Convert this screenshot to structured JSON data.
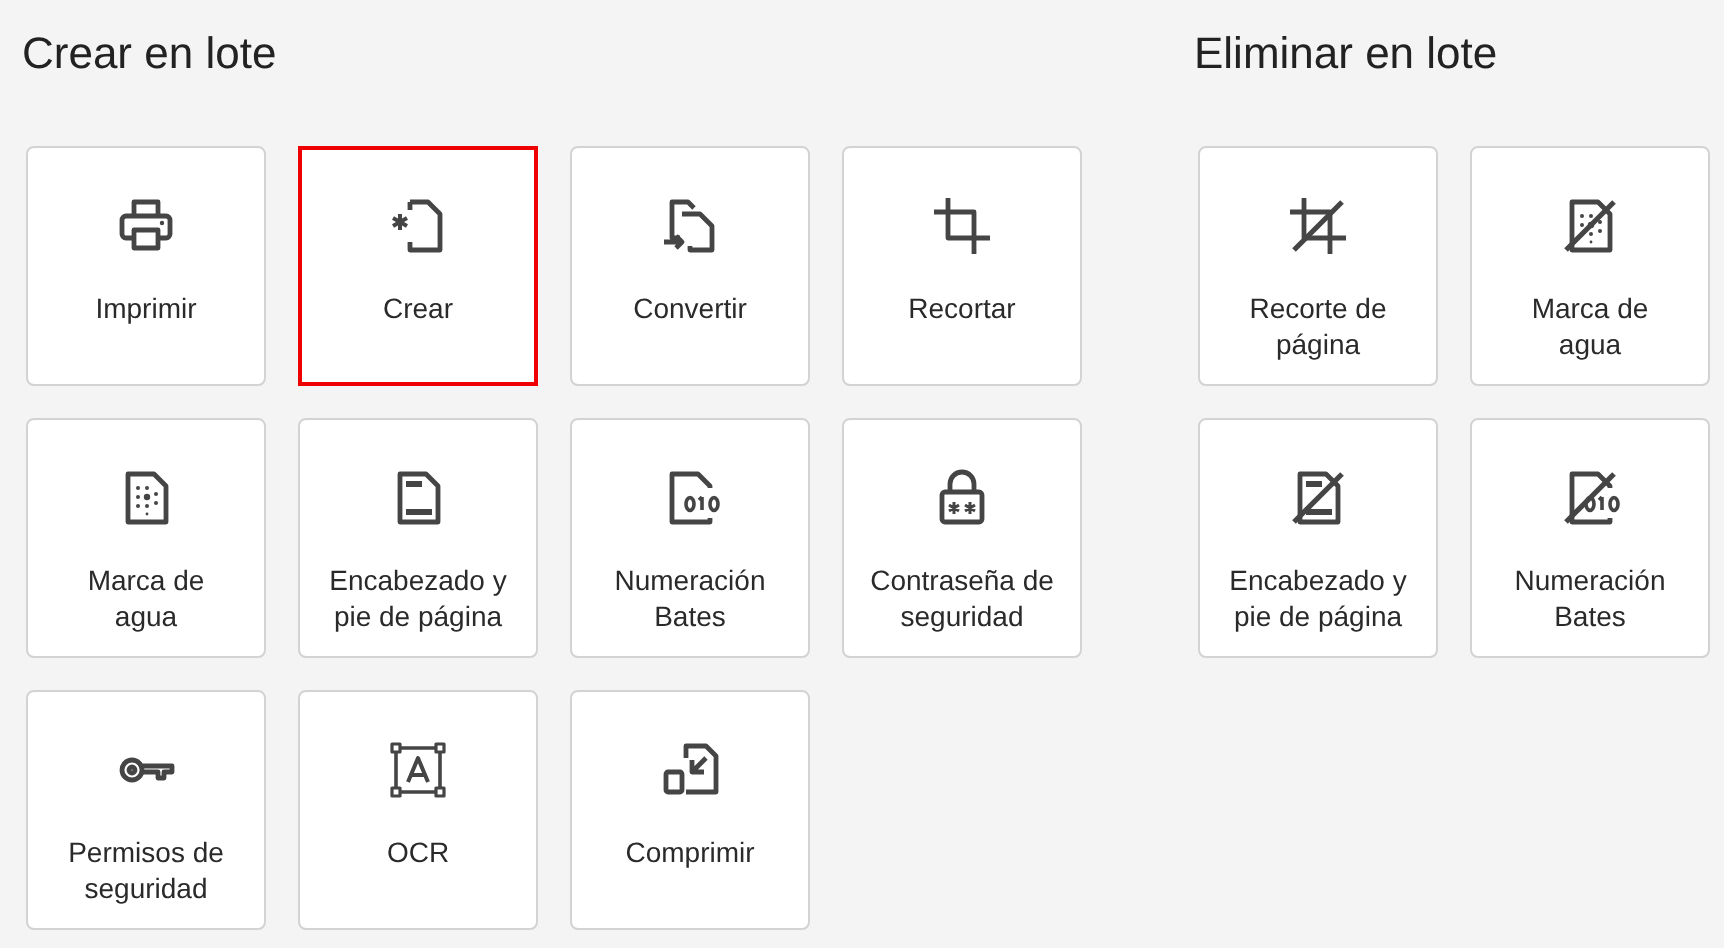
{
  "sections": [
    {
      "title": "Crear en lote",
      "items": [
        {
          "label": "Imprimir",
          "kind": "print",
          "selected": false
        },
        {
          "label": "Crear",
          "kind": "new",
          "selected": true
        },
        {
          "label": "Convertir",
          "kind": "convert",
          "selected": false
        },
        {
          "label": "Recortar",
          "kind": "crop",
          "selected": false
        },
        {
          "label": "Marca de\nagua",
          "kind": "watermark",
          "selected": false
        },
        {
          "label": "Encabezado y\npie de página",
          "kind": "header-footer",
          "selected": false
        },
        {
          "label": "Numeración\nBates",
          "kind": "bates",
          "selected": false
        },
        {
          "label": "Contraseña de\nseguridad",
          "kind": "password",
          "selected": false
        },
        {
          "label": "Permisos de\nseguridad",
          "kind": "permissions",
          "selected": false
        },
        {
          "label": "OCR",
          "kind": "ocr",
          "selected": false
        },
        {
          "label": "Comprimir",
          "kind": "compress",
          "selected": false
        }
      ]
    },
    {
      "title": "Eliminar en lote",
      "items": [
        {
          "label": "Recorte de\npágina",
          "kind": "crop-off",
          "selected": false
        },
        {
          "label": "Marca de\nagua",
          "kind": "watermark-off",
          "selected": false
        },
        {
          "label": "Encabezado y\npie de página",
          "kind": "header-footer-off",
          "selected": false
        },
        {
          "label": "Numeración\nBates",
          "kind": "bates-off",
          "selected": false
        }
      ]
    }
  ]
}
